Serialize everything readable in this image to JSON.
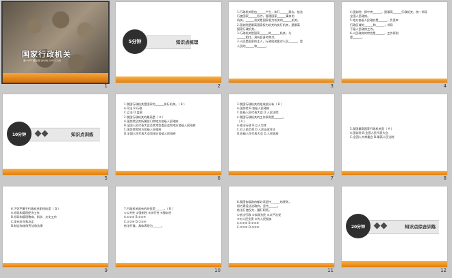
{
  "slides": [
    {
      "number": "1",
      "type": "cover",
      "title": "国家行政机关",
      "subtitle": "第一PPT模板网 WWW.1PPT.COM"
    },
    {
      "number": "2",
      "type": "section",
      "minutes": "5分钟",
      "label": "知识点梳理"
    },
    {
      "number": "3",
      "type": "text",
      "lines": [
        "1.行政机关是由______产生，执行______意志，依法",
        "行使国家______权力，管理国家______事务的",
        "机关。______机关是国家权力机关的______机关。",
        "2.国务院是最高国家权力机关的执行机关，是最高",
        "国家行政机关。",
        "3.行政机关是国家______的______机关，与",
        "______相比，具有自身的特点。",
        "3.人民是国家的主人，行政机关要对人民______，受",
        "人民的______和______。"
      ]
    },
    {
      "number": "4",
      "type": "text",
      "lines": [
        "4.国务院：即中央______，是最高______行政机关，统一领导",
        "全国人民政府。",
        "5.地方各级人民政府是______，负责本",
        "行政区域的______和______，领导",
        "下级人民政府工作。",
        "6.人民政府的宗旨是______，工作原则",
        "是______。"
      ]
    },
    {
      "number": "5",
      "type": "section",
      "minutes": "10分钟",
      "label": "知识点训练"
    },
    {
      "number": "6",
      "type": "text",
      "lines": [
        "1.我国行政机关是国家的______执行机关。（ B ）",
        "A.司法  B.行政",
        "C.立法  D.监察",
        "2.我国行政机关的最高是（ A ）",
        "A.国务院及其所属部门和地方各级人民政府",
        "B.全国人民代表大会及其常务委员会和地方各级人民政府",
        "C.国务院和地方各级人民政府",
        "D.全国人民代表大会和地方各级人民政府"
      ]
    },
    {
      "number": "7",
      "type": "text",
      "lines": [
        "3.我国行政机关的组成部分有（ B ）",
        "A.国务院  B.各级人民政府",
        "C.各级人民代表大会  D.人民法院",
        "4.我国行政机关的工作原则是______。",
        "（ A ）",
        "A.依法行政  B.以人为本",
        "C.对人民负责  D.人民当家作主",
        "D.各级人民代表大会  D.人民政府"
      ]
    },
    {
      "number": "8",
      "type": "text",
      "lines": [
        "5.我国最高国家行政机关是（ A ）",
        "A.国务院  B.全国人民代表大会",
        "C.全国人大常委会  D.最高人民法院"
      ]
    },
    {
      "number": "9",
      "type": "text",
      "lines": [
        "6.下列不属于行政机关职权的是（ D ）",
        "A.领导和管理经济工作",
        "B.领导和管理教育、科学、文化工作",
        "C.发布命令和决定",
        "D.制定和修改宪法和法律"
      ]
    },
    {
      "number": "10",
      "type": "text",
      "lines": [
        "7.行政机关具有的特征是______。（ B ）",
        "①公共性  ②强制性  ③执行性  ④服务性",
        "A.①②③  B.①②④",
        "C.②③④  D.①③④",
        "依法行政，具体表现为______。"
      ]
    },
    {
      "number": "11",
      "type": "text",
      "lines": [
        "8.我国各级政府都必须坚持______的原则，",
        "努力建设法治政府，坚持______，",
        "依法行使权力，履行职责。",
        "①依法行政  ②执政为民  ③从严治党",
        "④对人民负责  ⑤为人民服务",
        "A.①②③  B.①②⑤",
        "C.②③④  D.③④⑤"
      ]
    },
    {
      "number": "12",
      "type": "section",
      "minutes": "20分钟",
      "label": "知识点综合训练"
    }
  ],
  "colors": {
    "accent": "#e8901c",
    "answer": "#d40000",
    "badge": "#2f2f2f"
  }
}
